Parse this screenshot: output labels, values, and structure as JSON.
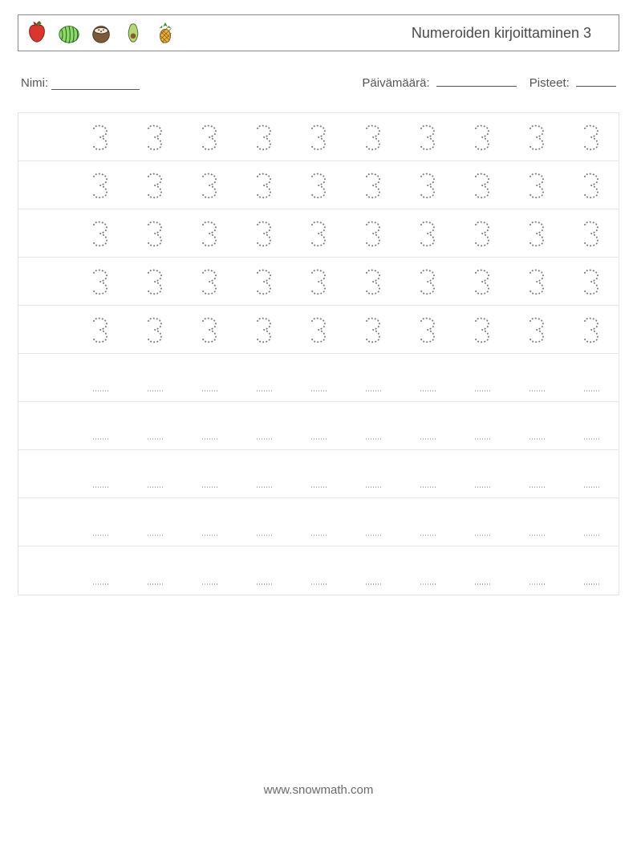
{
  "header": {
    "title": "Numeroiden kirjoittaminen 3",
    "fruits": [
      "apple",
      "watermelon",
      "coconut",
      "avocado",
      "pineapple"
    ]
  },
  "meta": {
    "name_label": "Nimi:",
    "date_label": "Päivämäärä:",
    "score_label": "Pisteet:"
  },
  "grid": {
    "rows": 10,
    "cols_with_leading_blank": true,
    "cols": 10,
    "trace_rows": 5,
    "trace_value": "3",
    "blank_rows": 5
  },
  "footer": {
    "url": "www.snowmath.com"
  }
}
